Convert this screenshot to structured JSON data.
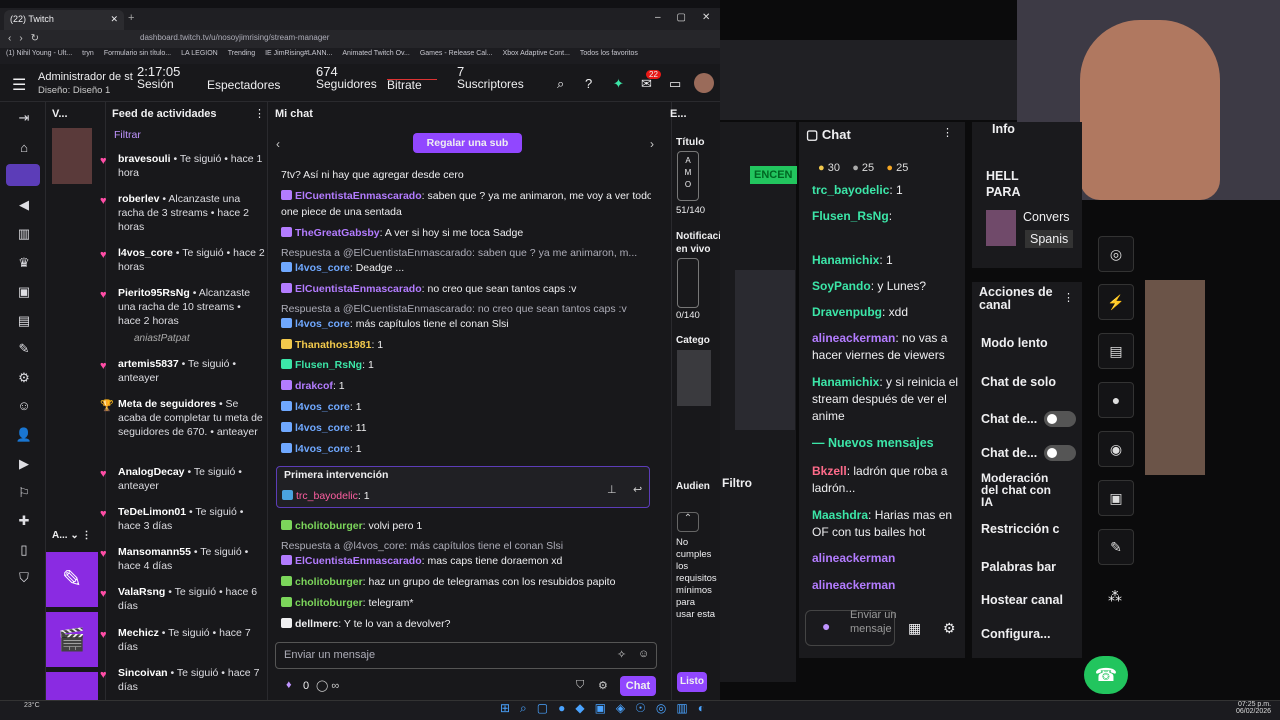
{
  "browser": {
    "tab_title": "(22) Twitch",
    "url": "dashboard.twitch.tv/u/nosoyjimrising/stream-manager",
    "bookmarks": [
      "(1) Nihil Young - Ult...",
      "tryn",
      "Formulario sin título...",
      "LA LEGION",
      "Trending",
      "IE JimRising#LANN...",
      "Animated Twitch Ov...",
      "Games - Release Cal...",
      "Xbox Adaptive Cont...",
      "Todos los favoritos"
    ]
  },
  "header": {
    "title": "Administrador de str",
    "subtitle": "Diseño: Diseño 1",
    "session_value": "2:17:05",
    "session_label": "Sesión",
    "viewers_label": "Espectadores",
    "followers_value": "674",
    "followers_label": "Seguidores",
    "bitrate_label": "Bitrate",
    "subs_value": "7",
    "subs_label": "Suscriptores",
    "notif_count": "22"
  },
  "panels": {
    "p1_title": "V...",
    "activity_title": "Feed de actividades",
    "filter": "Filtrar",
    "chat_title": "Mi chat",
    "right_title": "E..."
  },
  "activity": [
    {
      "user": "bravesouli",
      "text": " • Te siguió • hace 1 hora"
    },
    {
      "user": "roberlev",
      "text": " • Alcanzaste una racha de 3 streams • hace 2 horas"
    },
    {
      "user": "l4vos_core",
      "text": " • Te siguió • hace 2 horas"
    },
    {
      "user": "Pierito95RsNg",
      "text": " • Alcanzaste una racha de 10 streams • hace 2 horas"
    },
    {
      "user": "artemis5837",
      "text": " • Te siguió • anteayer"
    },
    {
      "user": "Meta de seguidores",
      "text": " • Se acaba de completar tu meta de seguidores de 670. • anteayer"
    },
    {
      "user": "AnalogDecay",
      "text": " • Te siguió • anteayer"
    },
    {
      "user": "TeDeLimon01",
      "text": " • Te siguió • hace 3 días"
    },
    {
      "user": "Mansomann55",
      "text": " • Te siguió • hace 4 días"
    },
    {
      "user": "ValaRsng",
      "text": " • Te siguió • hace 6 días"
    },
    {
      "user": "Mechicz",
      "text": " • Te siguió • hace 7 días"
    },
    {
      "user": "Sincoivan",
      "text": " • Te siguió • hace 7 días"
    }
  ],
  "activity_extra": "aniastPatpat",
  "chat": {
    "gift_button": "Regalar una sub",
    "first_label": "Primera intervención",
    "input_placeholder": "Enviar un mensaje",
    "points": "0",
    "send": "Chat",
    "done": "Listo",
    "messages": [
      {
        "user": "",
        "text": "7tv? Así ni hay que agregar desde cero",
        "color": "#efeff1"
      },
      {
        "user": "ElCuentistaEnmascarado",
        "text": ": saben que ? ya me animaron, me voy a ver todo",
        "color": "#b37cff"
      },
      {
        "user": "",
        "text": "one piece de una sentada",
        "color": "#efeff1"
      },
      {
        "user": "TheGreatGabsby",
        "text": ": A ver si hoy si me toca Sadge",
        "color": "#b37cff"
      },
      {
        "user": "",
        "text": "Respuesta a @ElCuentistaEnmascarado: saben que ? ya me animaron, m...",
        "color": "#adadb8"
      },
      {
        "user": "l4vos_core",
        "text": ": Deadge ...",
        "color": "#6fa8ff"
      },
      {
        "user": "ElCuentistaEnmascarado",
        "text": ": no creo que sean tantos caps :v",
        "color": "#b37cff"
      },
      {
        "user": "",
        "text": "Respuesta a @ElCuentistaEnmascarado: no creo que sean tantos caps :v",
        "color": "#adadb8"
      },
      {
        "user": "l4vos_core",
        "text": ": más capítulos tiene el conan Slsi",
        "color": "#6fa8ff"
      },
      {
        "user": "Thanathos1981",
        "text": ": 1",
        "color": "#f2c94c"
      },
      {
        "user": "Flusen_RsNg",
        "text": ": 1",
        "color": "#3ce6a8"
      },
      {
        "user": "drakcof",
        "text": ": 1",
        "color": "#b37cff"
      },
      {
        "user": "l4vos_core",
        "text": ": 1",
        "color": "#6fa8ff"
      },
      {
        "user": "l4vos_core",
        "text": ": 11",
        "color": "#6fa8ff"
      },
      {
        "user": "l4vos_core",
        "text": ": 1",
        "color": "#6fa8ff"
      }
    ],
    "first": {
      "user": "trc_bayodelic",
      "text": ": 1"
    },
    "after": [
      {
        "user": "cholitoburger",
        "text": ": volvi pero 1",
        "color": "#7cd65b"
      },
      {
        "user": "",
        "text": "Respuesta a @l4vos_core: más capítulos tiene el conan Slsi",
        "color": "#adadb8"
      },
      {
        "user": "ElCuentistaEnmascarado",
        "text": ": mas caps tiene doraemon xd",
        "color": "#b37cff"
      },
      {
        "user": "cholitoburger",
        "text": ": haz un grupo de telegramas con los resubidos papito",
        "color": "#7cd65b"
      },
      {
        "user": "cholitoburger",
        "text": ": telegram*",
        "color": "#7cd65b"
      },
      {
        "user": "dellmerc",
        "text": ": Y te lo van a devolver?",
        "color": "#efeff1"
      }
    ]
  },
  "right": {
    "title_label": "Título",
    "notif_label": "Notificación en vivo",
    "count1": "51/140",
    "count2": "0/140",
    "category_label": "Catego",
    "audience_label": "Audien",
    "audience_text": "No cumples los requisitos mínimos para usar esta"
  },
  "stream": {
    "chat_title": "Chat",
    "points": [
      "30",
      "25",
      "25"
    ],
    "actions_title": "Acciones de canal",
    "info_title": "Info",
    "new_messages": "Nuevos mensajes",
    "send_placeholder": "Enviar un mensaje",
    "filter": "Filtro",
    "lang": "Spanis",
    "conv": "Convers",
    "hello": "HELL PARA",
    "encend": "ENCEN",
    "chat": [
      {
        "user": "trc_bayodelic",
        "text": ": 1",
        "color": "#3ce6a8"
      },
      {
        "user": "Flusen_RsNg",
        "text": ":",
        "color": "#3ce6a8"
      },
      {
        "user": "Hanamichix",
        "text": ": 1",
        "color": "#3ce6a8"
      },
      {
        "user": "SoyPando",
        "text": ": y Lunes?",
        "color": "#3ce6a8"
      },
      {
        "user": "Dravenpubg",
        "text": ": xdd",
        "color": "#3ce6a8"
      },
      {
        "user": "alineackerman",
        "text": ": no vas a hacer viernes de viewers",
        "color": "#b37cff"
      },
      {
        "user": "Hanamichix",
        "text": ": y si reinicia el stream después de ver el anime",
        "color": "#3ce6a8"
      },
      {
        "user": "Bkzell",
        "text": ": ladrón que roba a ladrón...",
        "color": "#ff6b8a"
      },
      {
        "user": "Maashdra",
        "text": ": Harias mas en OF con tus bailes hot",
        "color": "#3ce6a8"
      },
      {
        "user": "alineackerman",
        "text": "",
        "color": "#b37cff"
      },
      {
        "user": "alineackerman",
        "text": "",
        "color": "#b37cff"
      }
    ],
    "actions": [
      "Modo lento",
      "Chat de solo",
      "Chat de...",
      "Chat de...",
      "Moderación del chat con IA",
      "Restricción c",
      "Palabras bar",
      "Hostear canal",
      "Configura..."
    ]
  },
  "taskbar": {
    "weather": "23°C",
    "time": "07:25 p.m.",
    "date": "06/02/2026"
  }
}
